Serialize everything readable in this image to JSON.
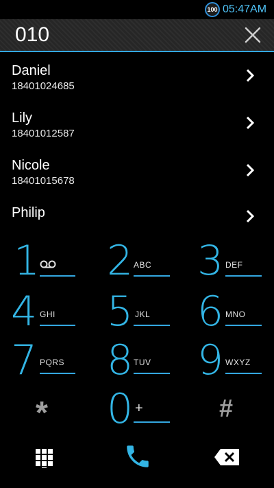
{
  "status_bar": {
    "battery_level": "100",
    "time": "05:47AM"
  },
  "search": {
    "value": "010"
  },
  "contacts": [
    {
      "name": "Daniel",
      "number": "18401024685"
    },
    {
      "name": "Lily",
      "number": "18401012587"
    },
    {
      "name": "Nicole",
      "number": "18401015678"
    },
    {
      "name": "Philip",
      "number": ""
    }
  ],
  "keypad": {
    "k1": {
      "digit": "1",
      "letters": ""
    },
    "k2": {
      "digit": "2",
      "letters": "ABC"
    },
    "k3": {
      "digit": "3",
      "letters": "DEF"
    },
    "k4": {
      "digit": "4",
      "letters": "GHI"
    },
    "k5": {
      "digit": "5",
      "letters": "JKL"
    },
    "k6": {
      "digit": "6",
      "letters": "MNO"
    },
    "k7": {
      "digit": "7",
      "letters": "PQRS"
    },
    "k8": {
      "digit": "8",
      "letters": "TUV"
    },
    "k9": {
      "digit": "9",
      "letters": "WXYZ"
    },
    "kstar": {
      "digit": "*"
    },
    "k0": {
      "digit": "0",
      "letters": "+"
    },
    "khash": {
      "digit": "#"
    }
  },
  "icons": {
    "voicemail": "voicemail-icon",
    "keypad_toggle": "dialpad-grid-icon",
    "call": "phone-icon",
    "backspace": "backspace-icon",
    "clear": "close-icon",
    "chevron": "chevron-right-icon"
  },
  "colors": {
    "accent": "#33b5e5",
    "background": "#000000",
    "clock": "#4fc3f7"
  }
}
